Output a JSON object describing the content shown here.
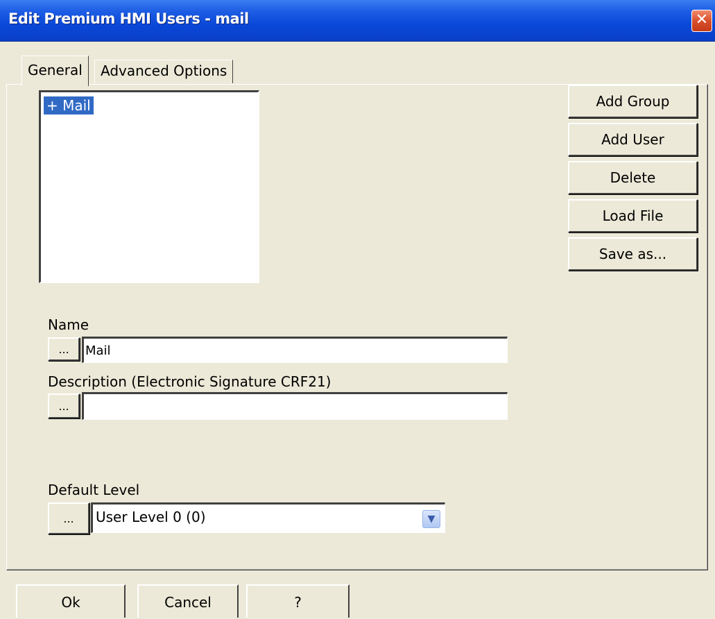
{
  "window": {
    "title": "Edit Premium HMI Users - mail",
    "close_glyph": "✕"
  },
  "tabs": [
    {
      "label": "General",
      "active": true
    },
    {
      "label": "Advanced Options",
      "active": false
    }
  ],
  "tree": {
    "items": [
      {
        "label": "+ Mail",
        "selected": true
      }
    ]
  },
  "side_buttons": {
    "add_group": "Add Group",
    "add_user": "Add User",
    "delete": "Delete",
    "load_file": "Load File",
    "save_as": "Save as..."
  },
  "fields": {
    "name_label": "Name",
    "name_value": "Mail",
    "description_label": "Description (Electronic Signature CRF21)",
    "description_value": "",
    "default_level_label": "Default Level",
    "default_level_value": "User Level 0 (0)",
    "browse_label": "..."
  },
  "footer": {
    "ok": "Ok",
    "cancel": "Cancel",
    "help": "?"
  },
  "colors": {
    "titlebar": "#0a48d8",
    "dialog_bg": "#ece9d8",
    "selection": "#316ac5"
  }
}
